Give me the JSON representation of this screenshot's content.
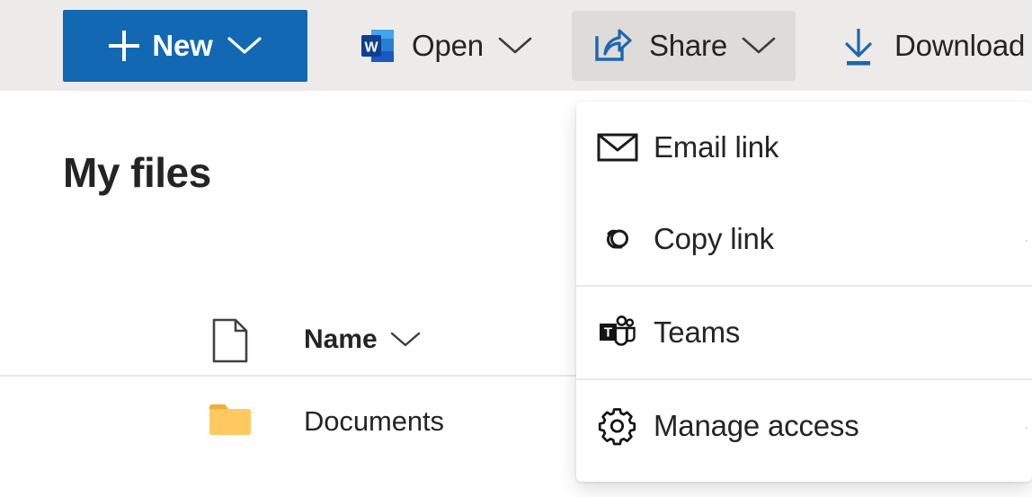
{
  "toolbar": {
    "buttons": [
      {
        "id": "new",
        "label": "New",
        "icon": "plus-icon",
        "has_chevron": true,
        "style": "primary"
      },
      {
        "id": "open",
        "label": "Open",
        "icon": "word-icon",
        "has_chevron": true,
        "style": "default"
      },
      {
        "id": "share",
        "label": "Share",
        "icon": "share-icon",
        "has_chevron": true,
        "style": "active"
      },
      {
        "id": "download",
        "label": "Download",
        "icon": "download-icon",
        "has_chevron": false,
        "style": "default"
      }
    ],
    "chevron_glyph": "∨"
  },
  "main": {
    "title": "My files",
    "column_header": {
      "icon": "document-icon",
      "label": "Name",
      "sort_chevron": "∨"
    },
    "rows": [
      {
        "icon": "folder-icon",
        "name": "Documents"
      }
    ]
  },
  "share_menu": {
    "items": [
      {
        "id": "email-link",
        "label": "Email link",
        "icon": "envelope-icon",
        "separator_after": false,
        "submenu_chevron": false
      },
      {
        "id": "copy-link",
        "label": "Copy link",
        "icon": "link-icon",
        "separator_after": true,
        "submenu_chevron": true
      },
      {
        "id": "teams",
        "label": "Teams",
        "icon": "teams-icon",
        "separator_after": true,
        "submenu_chevron": false
      },
      {
        "id": "manage-access",
        "label": "Manage access",
        "icon": "gear-icon",
        "separator_after": false,
        "submenu_chevron": true
      }
    ],
    "submenu_chevron_glyph": "›"
  },
  "colors": {
    "toolbar_bg": "#edebe9",
    "primary_blue": "#1268b3",
    "icon_blue": "#1b67b1",
    "active_btn_bg": "#dedbd9",
    "text": "#242424",
    "divider": "#ebe9e7",
    "folder_yellow": "#ffc862",
    "folder_yellow_dark": "#f5b945",
    "menu_bg": "#ffffff",
    "page_bg": "#ffffff"
  }
}
